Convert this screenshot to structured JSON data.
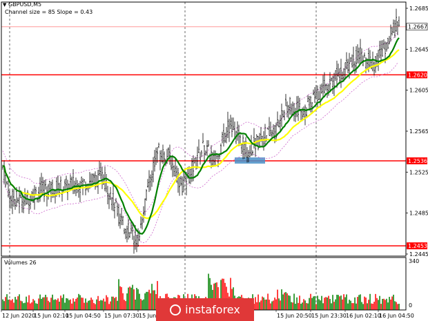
{
  "header": {
    "symbol": "GBPUSD,M5",
    "indicator_info": "Channel size = 85 Slope = 0.43",
    "volume_label": "Volumes 26"
  },
  "price_axis": {
    "ticks": [
      "1.2685",
      "1.2645",
      "1.2605",
      "1.2565",
      "1.2525",
      "1.2485",
      "1.2445"
    ],
    "current_price": "1.2667",
    "levels": [
      "1.2620",
      "1.2536",
      "1.2453"
    ]
  },
  "volume_axis": {
    "ticks": [
      "340",
      "0"
    ]
  },
  "time_axis": {
    "labels": [
      "12 Jun 2020",
      "15 Jun 02:10",
      "15 Jun 04:50",
      "15 Jun 07:30",
      "15 Jun 1",
      "15 Jun 20:50",
      "15 Jun 23:30",
      "16 Jun 02:10",
      "16 Jun 04:50"
    ]
  },
  "colors": {
    "level_line": "#ff0000",
    "level_tag": "#ff0000",
    "bull_volume": "#008000",
    "bear_volume": "#ff0000",
    "ma_green": "#008000",
    "ma_yellow": "#ffff00",
    "channel": "#cc66cc",
    "watermark": "#e03838"
  },
  "watermark": {
    "text": "instaforex",
    "icon": "instaforex-logo-icon"
  }
}
